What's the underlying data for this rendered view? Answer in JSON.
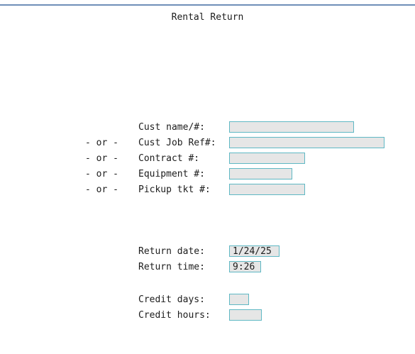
{
  "screen": {
    "title": "Rental Return"
  },
  "lookup": {
    "or_separator": "- or -",
    "cust_name_label": "Cust name/#:",
    "cust_job_ref_label": "Cust Job Ref#:",
    "contract_label": "Contract #:",
    "equipment_label": "Equipment #:",
    "pickup_tkt_label": "Pickup tkt #:",
    "cust_name_value": "",
    "cust_job_ref_value": "",
    "contract_value": "",
    "equipment_value": "",
    "pickup_tkt_value": ""
  },
  "return_info": {
    "return_date_label": "Return date:",
    "return_date_value": "1/24/25",
    "return_time_label": "Return time:",
    "return_time_value": "9:26"
  },
  "credit": {
    "credit_days_label": "Credit days:",
    "credit_days_value": "",
    "credit_hours_label": "Credit hours:",
    "credit_hours_value": ""
  }
}
